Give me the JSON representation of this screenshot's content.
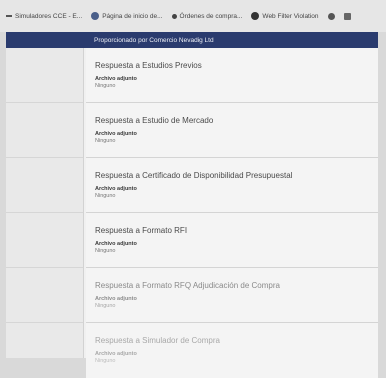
{
  "bookmarks": [
    {
      "label": "Simuladores CCE - E...",
      "icon": "dash-icon"
    },
    {
      "label": "Página de inicio de...",
      "icon": "globe-icon"
    },
    {
      "label": "Órdenes de compra...",
      "icon": "dot-icon"
    },
    {
      "label": "Web Filter Violation",
      "icon": "check-icon"
    }
  ],
  "header": {
    "text": "Proporcionado por Comercio Nevadig Ltd"
  },
  "cards": [
    {
      "title": "Respuesta a Estudios Previos",
      "attachment_label": "Archivo adjunto",
      "attachment_value": "Ninguno"
    },
    {
      "title": "Respuesta a Estudio de Mercado",
      "attachment_label": "Archivo adjunto",
      "attachment_value": "Ninguno"
    },
    {
      "title": "Respuesta a Certificado de Disponibilidad Presupuestal",
      "attachment_label": "Archivo adjunto",
      "attachment_value": "Ninguno"
    },
    {
      "title": "Respuesta a Formato RFI",
      "attachment_label": "Archivo adjunto",
      "attachment_value": "Ninguno"
    },
    {
      "title": "Respuesta a Formato RFQ Adjudicación de Compra",
      "attachment_label": "Archivo adjunto",
      "attachment_value": "Ninguno"
    },
    {
      "title": "Respuesta a Simulador de Compra",
      "attachment_label": "Archivo adjunto",
      "attachment_value": "Ninguno"
    }
  ],
  "colors": {
    "header_bg": "#2a3b6e",
    "page_bg": "#f0f0f0"
  }
}
